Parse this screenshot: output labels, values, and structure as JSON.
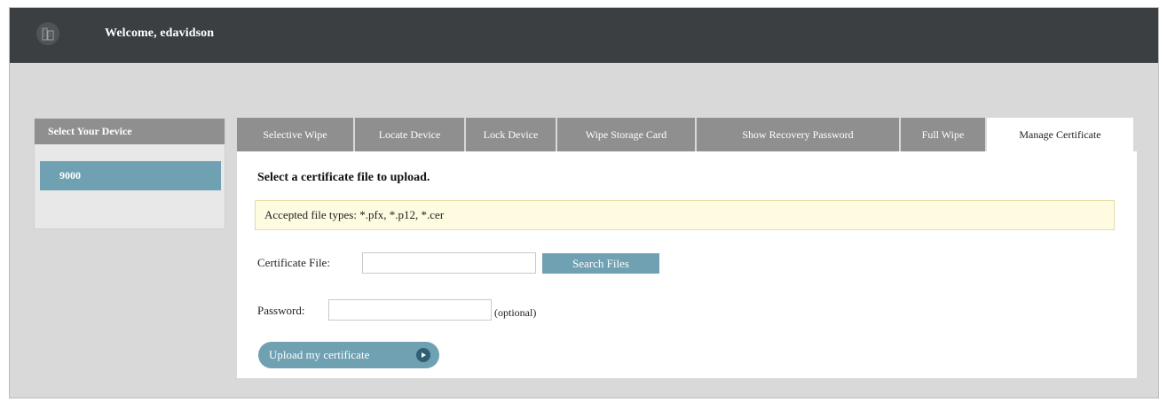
{
  "header": {
    "welcome": "Welcome, edavidson",
    "logo_icon": "building-icon"
  },
  "sidebar": {
    "title": "Select Your Device",
    "devices": [
      {
        "label": "9000",
        "selected": true
      }
    ]
  },
  "tabs": [
    {
      "label": "Selective Wipe",
      "active": false
    },
    {
      "label": "Locate Device",
      "active": false
    },
    {
      "label": "Lock Device",
      "active": false
    },
    {
      "label": "Wipe Storage Card",
      "active": false
    },
    {
      "label": "Show Recovery Password",
      "active": false
    },
    {
      "label": "Full Wipe",
      "active": false
    },
    {
      "label": "Manage Certificate",
      "active": true
    }
  ],
  "panel": {
    "title": "Select a certificate file to upload.",
    "info": "Accepted file types: *.pfx, *.p12, *.cer",
    "certificate_label": "Certificate File:",
    "certificate_value": "",
    "search_button": "Search Files",
    "password_label": "Password:",
    "password_value": "",
    "optional_note": "(optional)",
    "upload_button": "Upload my certificate",
    "upload_icon": "play-circle-icon"
  },
  "colors": {
    "topbar": "#3b3f42",
    "accent": "#6fa1b2",
    "tab_inactive": "#8f8f8f",
    "info_bg": "#fefbe0"
  }
}
